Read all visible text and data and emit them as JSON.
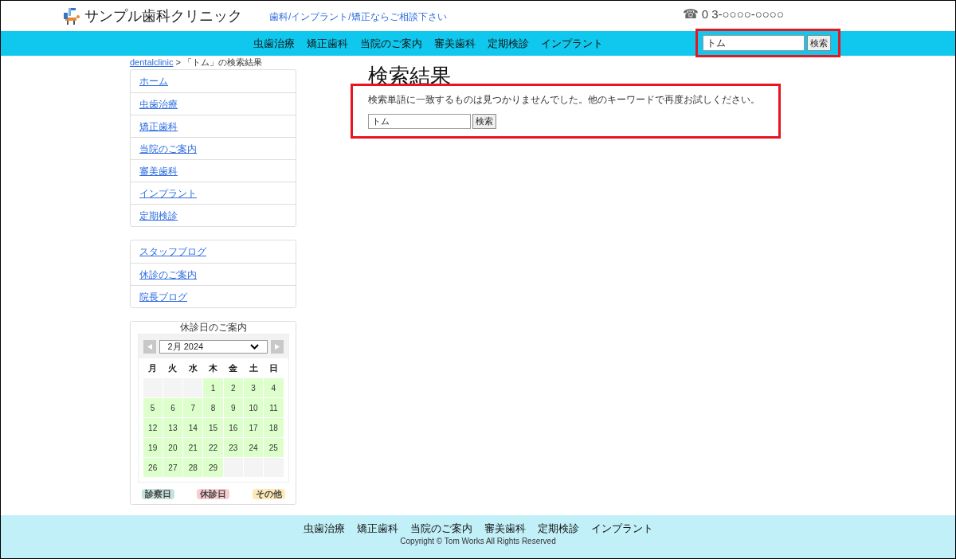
{
  "header": {
    "site_title": "サンプル歯科クリニック",
    "tagline": "歯科/インプラント/矯正ならご相談下さい",
    "phone_symbol": "☎",
    "phone": "0 3-○○○○-○○○○"
  },
  "nav": [
    "虫歯治療",
    "矯正歯科",
    "当院のご案内",
    "審美歯科",
    "定期検診",
    "インプラント"
  ],
  "header_search": {
    "value": "トム",
    "button": "検索",
    "highlighted": true
  },
  "breadcrumb": {
    "link": "dentalclinic",
    "separator": ">",
    "current": "「トム」の検索結果"
  },
  "sidebar": {
    "menu": [
      "ホーム",
      "虫歯治療",
      "矯正歯科",
      "当院のご案内",
      "審美歯科",
      "インプラント",
      "定期検診"
    ],
    "links": [
      "スタッフブログ",
      "休診のご案内",
      "院長ブログ"
    ],
    "calendar": {
      "title": "休診日のご案内",
      "month": "2月 2024",
      "weekdays": [
        "月",
        "火",
        "水",
        "木",
        "金",
        "土",
        "日"
      ],
      "weeks": [
        [
          {
            "kind": "blank"
          },
          {
            "kind": "blank"
          },
          {
            "kind": "blank"
          },
          {
            "kind": "day",
            "day": "1",
            "color": "#ddffcc"
          },
          {
            "kind": "day",
            "day": "2",
            "color": "#ddffcc"
          },
          {
            "kind": "day",
            "day": "3",
            "color": "#ddffcc"
          },
          {
            "kind": "day",
            "day": "4",
            "color": "#ddffcc"
          }
        ],
        [
          {
            "kind": "day",
            "day": "5",
            "color": "#ddffcc"
          },
          {
            "kind": "day",
            "day": "6",
            "color": "#ddffcc"
          },
          {
            "kind": "day",
            "day": "7",
            "color": "#ddffcc"
          },
          {
            "kind": "day",
            "day": "8",
            "color": "#ddffcc"
          },
          {
            "kind": "day",
            "day": "9",
            "color": "#ddffcc"
          },
          {
            "kind": "day",
            "day": "10",
            "color": "#ddffcc"
          },
          {
            "kind": "day",
            "day": "11",
            "color": "#ddffcc"
          }
        ],
        [
          {
            "kind": "day",
            "day": "12",
            "color": "#ddffcc"
          },
          {
            "kind": "day",
            "day": "13",
            "color": "#ddffcc"
          },
          {
            "kind": "day",
            "day": "14",
            "color": "#ddffcc"
          },
          {
            "kind": "day",
            "day": "15",
            "color": "#ddffcc"
          },
          {
            "kind": "day",
            "day": "16",
            "color": "#ddffcc"
          },
          {
            "kind": "day",
            "day": "17",
            "color": "#ddffcc"
          },
          {
            "kind": "day",
            "day": "18",
            "color": "#ddffcc"
          }
        ],
        [
          {
            "kind": "day",
            "day": "19",
            "color": "#ddffcc"
          },
          {
            "kind": "day",
            "day": "20",
            "color": "#ddffcc"
          },
          {
            "kind": "day",
            "day": "21",
            "color": "#ddffcc"
          },
          {
            "kind": "day",
            "day": "22",
            "color": "#ddffcc"
          },
          {
            "kind": "day",
            "day": "23",
            "color": "#ddffcc"
          },
          {
            "kind": "day",
            "day": "24",
            "color": "#ddffcc"
          },
          {
            "kind": "day",
            "day": "25",
            "color": "#ddffcc"
          }
        ],
        [
          {
            "kind": "day",
            "day": "26",
            "color": "#ddffcc"
          },
          {
            "kind": "day",
            "day": "27",
            "color": "#ddffcc"
          },
          {
            "kind": "day",
            "day": "28",
            "color": "#ddffcc"
          },
          {
            "kind": "day",
            "day": "29",
            "color": "#ddffcc"
          },
          {
            "kind": "blank"
          },
          {
            "kind": "blank"
          },
          {
            "kind": "blank"
          }
        ]
      ],
      "legend": [
        {
          "label": "診察日",
          "color": "#c6e2dc"
        },
        {
          "label": "休診日",
          "color": "#f8cdd1"
        },
        {
          "label": "その他",
          "color": "#fde9b5"
        }
      ]
    }
  },
  "results": {
    "title": "検索結果",
    "highlighted": true,
    "message": "検索単語に一致するものは見つかりませんでした。他のキーワードで再度お試しください。",
    "search": {
      "value": "トム",
      "button": "検索"
    }
  },
  "footer": {
    "nav": [
      "虫歯治療",
      "矯正歯科",
      "当院のご案内",
      "審美歯科",
      "定期検診",
      "インプラント"
    ],
    "copyright": "Copyright © Tom Works All Rights Reserved"
  }
}
